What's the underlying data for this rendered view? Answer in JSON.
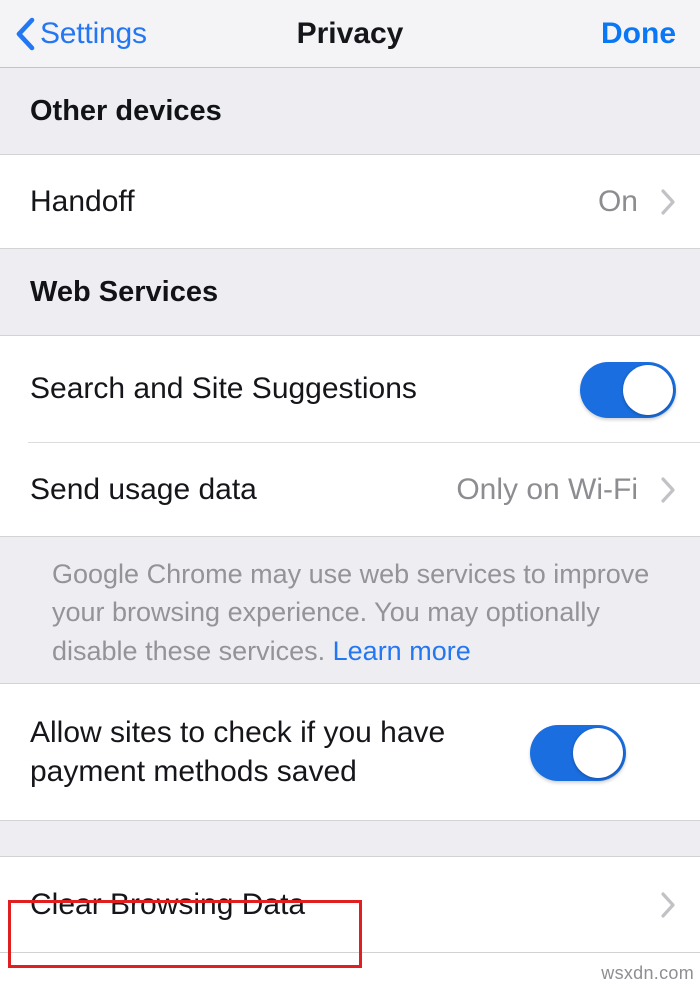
{
  "navbar": {
    "back_label": "Settings",
    "title": "Privacy",
    "done_label": "Done",
    "back_icon": "chevron-left-icon",
    "accent_color": "#0a78f5"
  },
  "sections": [
    {
      "header": "Other devices",
      "rows": [
        {
          "label": "Handoff",
          "value": "On",
          "accessory": "chevron-right-icon"
        }
      ]
    },
    {
      "header": "Web Services",
      "rows": [
        {
          "label": "Search and Site Suggestions",
          "accessory": "toggle",
          "toggle_on": true
        },
        {
          "label": "Send usage data",
          "value": "Only on Wi-Fi",
          "accessory": "chevron-right-icon"
        }
      ],
      "footnote": {
        "text": "Google Chrome may use web services to improve your browsing experience. You may optionally disable these services. ",
        "link": "Learn more"
      }
    },
    {
      "header": null,
      "rows": [
        {
          "label": "Allow sites to check if you have payment methods saved",
          "accessory": "toggle",
          "toggle_on": true
        }
      ]
    },
    {
      "header": null,
      "rows": [
        {
          "label": "Clear Browsing Data",
          "accessory": "chevron-right-icon",
          "highlighted": true
        }
      ]
    }
  ],
  "highlight": {
    "color": "#e02020"
  },
  "watermark": "wsxdn.com"
}
